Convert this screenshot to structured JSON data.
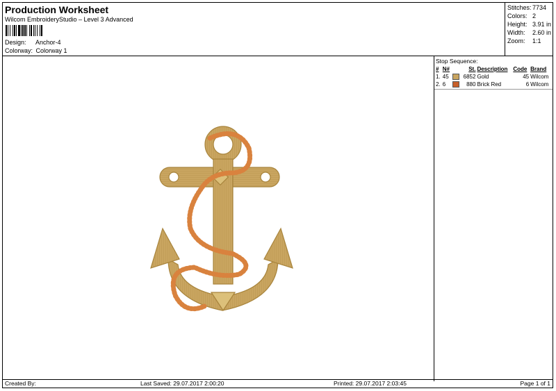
{
  "header": {
    "title": "Production Worksheet",
    "subtitle": "Wilcom EmbroideryStudio – Level 3 Advanced",
    "design_label": "Design:",
    "design_value": "Anchor-4",
    "colorway_label": "Colorway:",
    "colorway_value": "Colorway 1"
  },
  "stats": {
    "stitches_label": "Stitches:",
    "stitches_value": "7734",
    "colors_label": "Colors:",
    "colors_value": "2",
    "height_label": "Height:",
    "height_value": "3.91 in",
    "width_label": "Width:",
    "width_value": "2.60 in",
    "zoom_label": "Zoom:",
    "zoom_value": "1:1"
  },
  "stop_sequence": {
    "title": "Stop Sequence:",
    "headers": [
      "#",
      "N#",
      "St.",
      "Description",
      "Code",
      "Brand"
    ],
    "rows": [
      {
        "index": "1.",
        "n": "45",
        "color": "#c9a560",
        "stitches": "6852",
        "description": "Gold",
        "code": "45",
        "brand": "Wilcom"
      },
      {
        "index": "2.",
        "n": "6",
        "color": "#c8602a",
        "stitches": "880",
        "description": "Brick Red",
        "code": "6",
        "brand": "Wilcom"
      }
    ]
  },
  "footer": {
    "created_by": "Created By:",
    "last_saved": "Last Saved: 29.07.2017 2:00:20",
    "printed": "Printed: 29.07.2017 2:03:45",
    "page": "Page 1 of 1"
  },
  "colors": {
    "gold": "#c9a560",
    "gold_dark": "#a8843c",
    "gold_light": "#dcc07a",
    "rope": "#d9823e"
  }
}
